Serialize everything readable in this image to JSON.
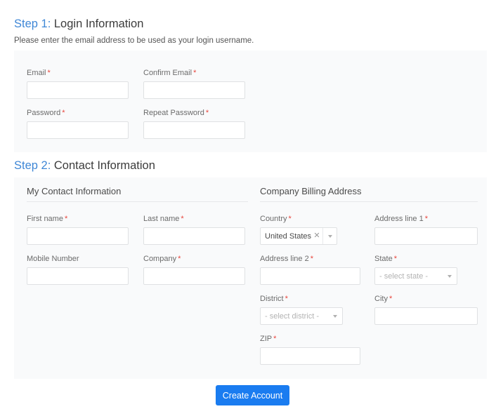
{
  "step1": {
    "step_label": "Step 1:",
    "title": " Login Information",
    "subtitle": "Please enter the email address to be used as your login username.",
    "fields": [
      {
        "label": "Email",
        "required": true,
        "value": "",
        "placeholder": ""
      },
      {
        "label": "Confirm Email",
        "required": true,
        "value": "",
        "placeholder": ""
      },
      {
        "label": "Password",
        "required": true,
        "value": "",
        "placeholder": ""
      },
      {
        "label": "Repeat Password",
        "required": true,
        "value": "",
        "placeholder": ""
      }
    ]
  },
  "step2": {
    "step_label": "Step 2:",
    "title": " Contact Information",
    "contact_section": {
      "title": "My Contact Information",
      "fields": [
        {
          "label": "First name",
          "required": true,
          "value": "",
          "placeholder": ""
        },
        {
          "label": "Last name",
          "required": true,
          "value": "",
          "placeholder": ""
        },
        {
          "label": "Mobile Number",
          "required": false,
          "value": "",
          "placeholder": ""
        },
        {
          "label": "Company",
          "required": true,
          "value": "",
          "placeholder": ""
        }
      ]
    },
    "billing_section": {
      "title": "Company Billing Address",
      "country": {
        "label": "Country",
        "required": true,
        "selected": "United States",
        "clear_icon": "close-icon",
        "caret_icon": "chevron-down-icon"
      },
      "address_line_1": {
        "label": "Address line 1",
        "required": true,
        "value": "",
        "placeholder": ""
      },
      "address_line_2": {
        "label": "Address line 2",
        "required": true,
        "value": "",
        "placeholder": ""
      },
      "state": {
        "label": "State",
        "required": true,
        "selected": "- select state -",
        "caret_icon": "chevron-down-icon"
      },
      "district": {
        "label": "District",
        "required": true,
        "selected": "- select district -",
        "caret_icon": "chevron-down-icon"
      },
      "city": {
        "label": "City",
        "required": true,
        "value": "",
        "placeholder": ""
      },
      "zip": {
        "label": "ZIP",
        "required": true,
        "value": "",
        "placeholder": ""
      }
    }
  },
  "footer": {
    "submit_label": "Create Account"
  },
  "colors": {
    "accent_blue": "#3f87d6",
    "button_blue": "#1a7cf0",
    "required_red": "#e8453c",
    "panel_bg": "#f9fafb",
    "input_border": "#dfe1e3"
  },
  "required_marker": "*"
}
